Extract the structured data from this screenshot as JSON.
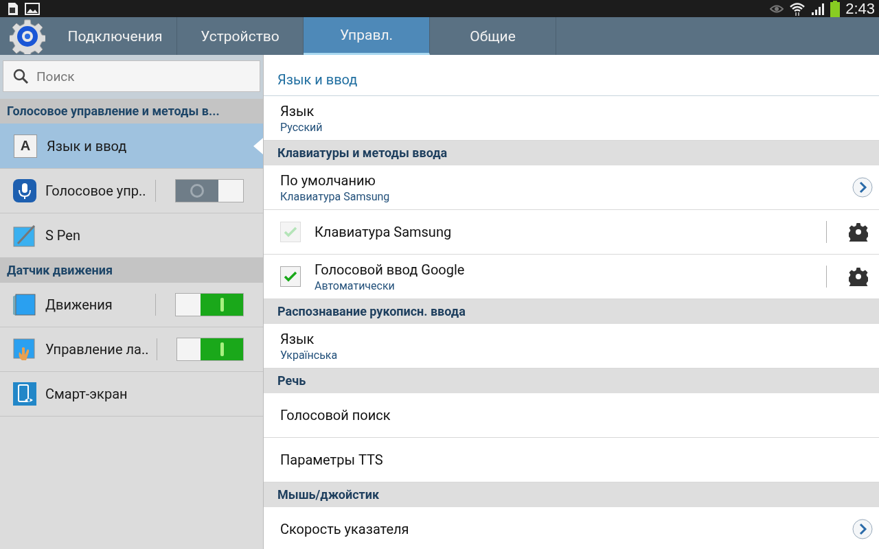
{
  "status_bar": {
    "time": "2:43"
  },
  "tabs": [
    {
      "label": "Подключения",
      "selected": false
    },
    {
      "label": "Устройство",
      "selected": false
    },
    {
      "label": "Управл.",
      "selected": true
    },
    {
      "label": "Общие",
      "selected": false
    }
  ],
  "search": {
    "placeholder": "Поиск"
  },
  "sidebar": {
    "items": [
      {
        "kind": "section",
        "label": "Голосовое управление и методы в..."
      },
      {
        "kind": "item",
        "icon_letter": "A",
        "label": "Язык и ввод",
        "selected": true
      },
      {
        "kind": "switch",
        "label": "Голосовое упр..",
        "selected": false,
        "on": false
      },
      {
        "kind": "item",
        "label": "S Pen",
        "selected": false
      },
      {
        "kind": "section",
        "label": "Датчик движения"
      },
      {
        "kind": "switch",
        "label": "Движения",
        "selected": false,
        "on": true
      },
      {
        "kind": "switch",
        "label": "Управление ла..",
        "selected": false,
        "on": true
      },
      {
        "kind": "item",
        "label": "Смарт-экран",
        "selected": false
      }
    ]
  },
  "content": {
    "title": "Язык и ввод",
    "rows": [
      {
        "kind": "row",
        "title": "Язык",
        "summary": "Русский"
      },
      {
        "kind": "section",
        "title": "Клавиатуры и методы ввода"
      },
      {
        "kind": "link",
        "title": "По умолчанию",
        "summary": "Клавиатура Samsung"
      },
      {
        "kind": "check",
        "title": "Клавиатура Samsung",
        "checked": true,
        "disabled": true,
        "settings": true
      },
      {
        "kind": "check",
        "title": "Голосовой ввод Google",
        "summary": "Автоматически",
        "checked": true,
        "disabled": false,
        "settings": true
      },
      {
        "kind": "section",
        "title": "Распознавание рукописн. ввода"
      },
      {
        "kind": "row",
        "title": "Язык",
        "summary": "Українська"
      },
      {
        "kind": "section",
        "title": "Речь"
      },
      {
        "kind": "row",
        "title": "Голосовой поиск"
      },
      {
        "kind": "row",
        "title": "Параметры TTS"
      },
      {
        "kind": "section",
        "title": "Мышь/джойстик"
      },
      {
        "kind": "link",
        "title": "Скорость указателя"
      }
    ]
  }
}
